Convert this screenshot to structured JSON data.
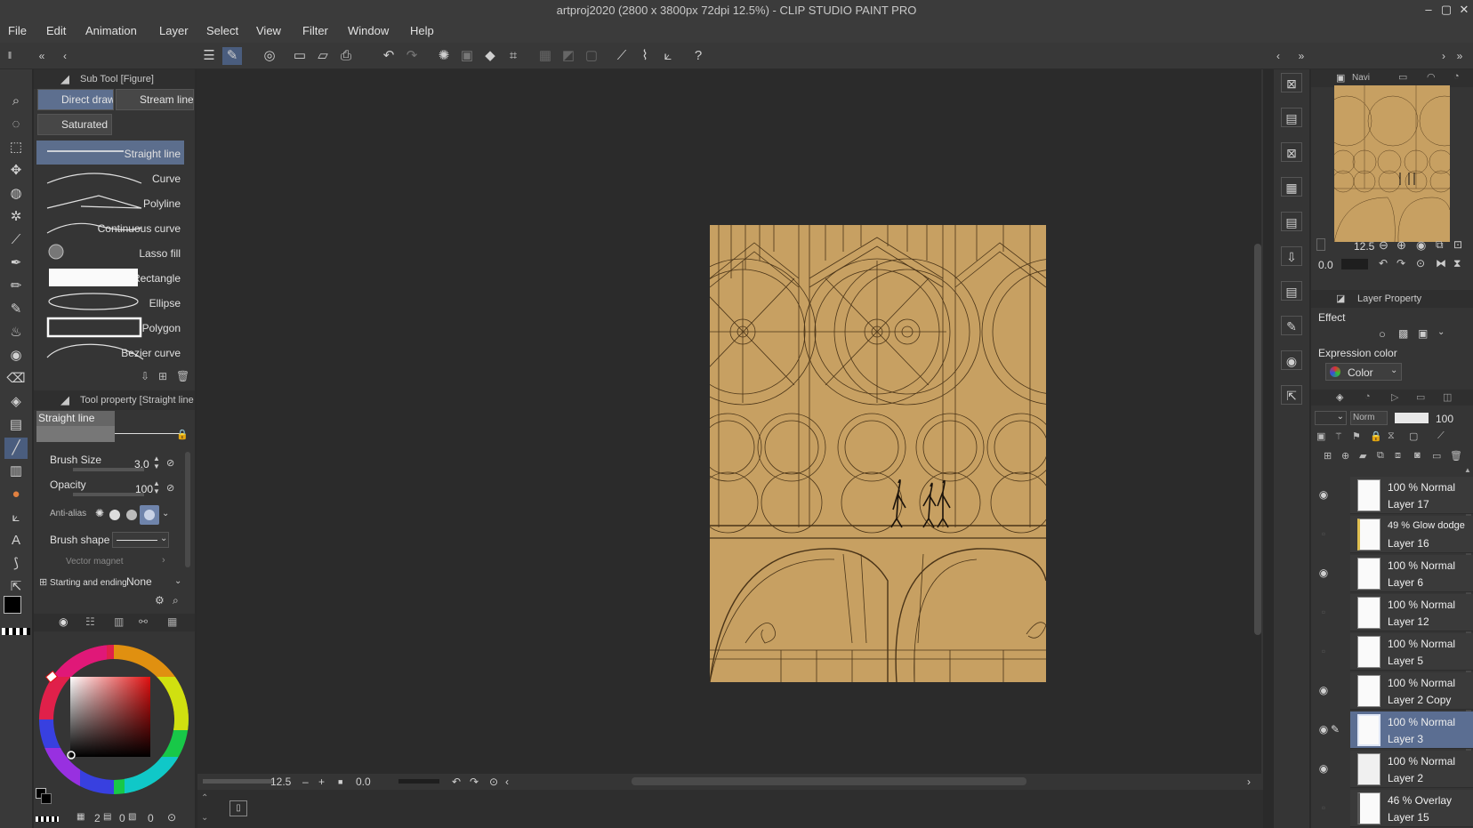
{
  "window": {
    "title": "artproj2020 (2800 x 3800px 72dpi 12.5%) - CLIP STUDIO PAINT PRO"
  },
  "menu": [
    "File",
    "Edit",
    "Animation",
    "Layer",
    "Select",
    "View",
    "Filter",
    "Window",
    "Help"
  ],
  "subtool": {
    "header": "Sub Tool [Figure]",
    "groups": [
      "Direct draw",
      "Stream line",
      "Saturated l"
    ],
    "items": [
      "Straight line",
      "Curve",
      "Polyline",
      "Continuous curve",
      "Lasso fill",
      "Rectangle",
      "Ellipse",
      "Polygon",
      "Bezier curve"
    ]
  },
  "toolprop": {
    "header": "Tool property [Straight line",
    "preset": "Straight line",
    "brush_size_label": "Brush Size",
    "brush_size": "3.0",
    "opacity_label": "Opacity",
    "opacity": "100",
    "antialias_label": "Anti-alias",
    "brush_shape_label": "Brush shape",
    "vector_magnet_label": "Vector magnet",
    "start_end_label": "Starting and ending",
    "start_end_value": "None"
  },
  "color": {
    "main": "#000000",
    "sub": "#ffffff",
    "footer": [
      "2",
      "0",
      "0"
    ]
  },
  "canvas": {
    "zoom": "12.5",
    "rotation": "0.0"
  },
  "navigator": {
    "label": "Navi",
    "zoom": "12.5",
    "rotation": "0.0"
  },
  "layer_property": {
    "header": "Layer Property",
    "effect_label": "Effect",
    "expression_label": "Expression color",
    "expression_value": "Color"
  },
  "layers_panel": {
    "blend": "Norm",
    "opacity": "100"
  },
  "layers": [
    {
      "mode": "100 % Normal",
      "name": "Layer 17",
      "visible": true,
      "active": false
    },
    {
      "mode": "49 % Glow dodge",
      "name": "Layer 16",
      "visible": false,
      "active": false
    },
    {
      "mode": "100 % Normal",
      "name": "Layer 6",
      "visible": true,
      "active": false
    },
    {
      "mode": "100 % Normal",
      "name": "Layer 12",
      "visible": false,
      "active": false
    },
    {
      "mode": "100 % Normal",
      "name": "Layer 5",
      "visible": false,
      "active": false
    },
    {
      "mode": "100 % Normal",
      "name": "Layer 2 Copy",
      "visible": true,
      "active": false
    },
    {
      "mode": "100 % Normal",
      "name": "Layer 3",
      "visible": true,
      "active": true
    },
    {
      "mode": "100 % Normal",
      "name": "Layer 2",
      "visible": true,
      "active": false
    },
    {
      "mode": "46 % Overlay",
      "name": "Layer 15",
      "visible": false,
      "active": false
    }
  ],
  "icons": {
    "toolbar": [
      "menu-icon",
      "pen-icon",
      "layer-icon",
      "new-icon",
      "open-icon",
      "save-icon",
      "undo-icon",
      "redo-icon",
      "transform-icon",
      "fill-icon",
      "crop-icon",
      "ruler-icon",
      "brush-icon",
      "help-icon"
    ],
    "tools": [
      "zoom-icon",
      "lasso-icon",
      "select-icon",
      "move-icon",
      "rotate-icon",
      "magic-wand-icon",
      "eyedropper-icon",
      "pen-icon",
      "pencil-icon",
      "brush-icon",
      "airbrush-icon",
      "blend-icon",
      "eraser-icon",
      "fill-icon",
      "gradient-icon",
      "figure-icon",
      "frame-icon",
      "eraser-icon",
      "ruler-icon",
      "text-icon",
      "balloon-icon",
      "operation-icon"
    ]
  }
}
